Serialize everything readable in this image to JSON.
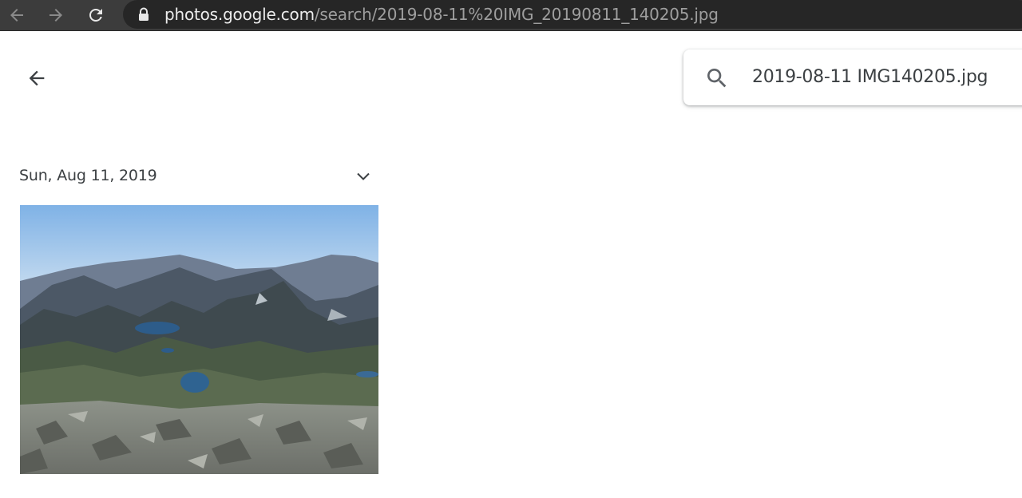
{
  "browser": {
    "url_host": "photos.google.com",
    "url_path": "/search/2019-08-11%20IMG_20190811_140205.jpg",
    "icons": {
      "back": "arrow-left-icon",
      "forward": "arrow-right-icon",
      "reload": "reload-icon",
      "lock": "lock-icon"
    }
  },
  "page": {
    "back_icon": "arrow-left-icon",
    "search": {
      "query": "2019-08-11 IMG140205.jpg",
      "icon": "search-icon"
    },
    "results": {
      "date_label": "Sun, Aug 11, 2019",
      "expand_icon": "chevron-down-icon",
      "photos": [
        {
          "description_icon": "photo-thumbnail"
        }
      ]
    }
  },
  "colors": {
    "toolbar_bg": "#3c3c3c",
    "omnibox_bg": "#262626",
    "text_primary": "#3c4043"
  }
}
